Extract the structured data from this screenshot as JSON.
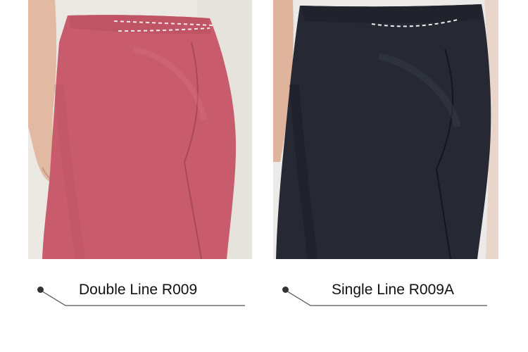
{
  "products": [
    {
      "label": "Double Line R009",
      "color_name": "pink",
      "color": "#c85c6c",
      "background": "#ece8e3",
      "waistband_stitch": "double dashed line"
    },
    {
      "label": "Single Line R009A",
      "color_name": "black",
      "color": "#262933",
      "background": "#eceae8",
      "waistband_stitch": "single dashed line"
    }
  ]
}
